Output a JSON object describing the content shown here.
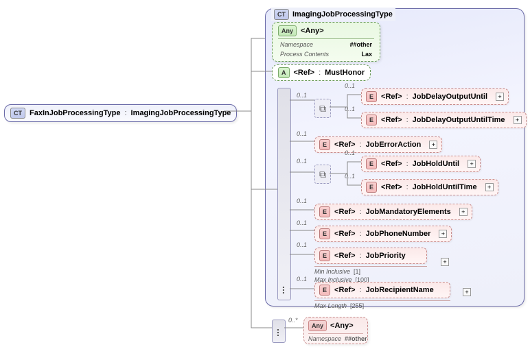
{
  "root": {
    "badge": "CT",
    "name": "FaxInJobProcessingType",
    "base": "ImagingJobProcessingType"
  },
  "ct": {
    "badge": "CT",
    "title": "ImagingJobProcessingType"
  },
  "anyTop": {
    "badge": "Any",
    "label": "<Any>",
    "rows": [
      [
        "Namespace",
        "##other"
      ],
      [
        "Process Contents",
        "Lax"
      ]
    ]
  },
  "attr": {
    "badge": "A",
    "ref": "<Ref>",
    "name": "MustHonor"
  },
  "occ01": "0..1",
  "occ0s": "0..*",
  "ref": "<Ref>",
  "eBadge": "E",
  "elems": {
    "jdoUntil": "JobDelayOutputUntil",
    "jdoUntilTime": "JobDelayOutputUntilTime",
    "errAction": "JobErrorAction",
    "holdUntil": "JobHoldUntil",
    "holdUntilT": "JobHoldUntilTime",
    "mandatory": "JobMandatoryElements",
    "phone": "JobPhoneNumber",
    "priority": "JobPriority",
    "recipient": "JobRecipientName"
  },
  "priorityC": {
    "minK": "Min Inclusive",
    "minV": "[1]",
    "maxK": "Max Inclusive",
    "maxV": "[100]"
  },
  "recipC": {
    "lenK": "Max Length",
    "lenV": "[255]"
  },
  "anyBot": {
    "badge": "Any",
    "label": "<Any>",
    "rowK": "Namespace",
    "rowV": "##other"
  }
}
